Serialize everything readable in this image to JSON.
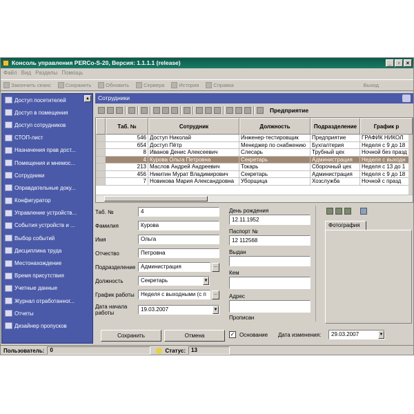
{
  "window": {
    "title": "Консоль управления PERCo-S-20, Версия: 1.1.1.1 (release)"
  },
  "menu": [
    "Файл",
    "Вид",
    "Разделы",
    "Помощь"
  ],
  "toolbar": {
    "items": [
      "Закончить сеанс",
      "Сохранить",
      "Обновить",
      "Сервера",
      "История",
      "Справка"
    ],
    "exit": "Выход"
  },
  "sidebar": {
    "items": [
      "Доступ посетителей",
      "Доступ в помещения",
      "Доступ сотрудников",
      "СТОП-лист",
      "Назначения прав дост...",
      "Помещения и мнемос...",
      "Сотрудники",
      "Оправдательные доку...",
      "Конфигуратор",
      "Управление устройств...",
      "События устройств и ...",
      "Выбор событий",
      "Дисциплина труда",
      "Местонахождение",
      "Время присутствия",
      "Учетные данные",
      "Журнал отработанног...",
      "Отчеты",
      "Дизайнер пропусков"
    ]
  },
  "panel": {
    "title": "Сотрудники",
    "filter_label": "Предприятие"
  },
  "table": {
    "headers": [
      "Таб. №",
      "Сотрудник",
      "Должность",
      "Подразделение",
      "График р"
    ],
    "rows": [
      [
        "546",
        "Доступ Николай",
        "Инженер-тестировщик",
        "Предприятие",
        "ГРАФИК НИКОЛ"
      ],
      [
        "654",
        "Доступ Пётр",
        "Менеджер по снабжению",
        "Бухгалтерия",
        "Неделя с 9 до 18"
      ],
      [
        "8",
        "Иванов Денис Алексеевич",
        "Слесарь",
        "Трубный цех",
        "Ночной без празд"
      ],
      [
        "4",
        "Курова Ольга Петровна",
        "Секретарь",
        "Администрация",
        "Неделя с выходн"
      ],
      [
        "213",
        "Маслов Андрей Андреевич",
        "Токарь",
        "Сборочный цех",
        "Неделя с 13 до 1"
      ],
      [
        "456",
        "Никитин Мурат Владимирович",
        "Секретарь",
        "Администрация",
        "Неделя с 9 до 18"
      ],
      [
        "7",
        "Новикова Мария Александровна",
        "Уборщица",
        "Хозслужба",
        "Ночной с празд"
      ]
    ],
    "selected_index": 3
  },
  "form": {
    "tab_no_label": "Таб. №",
    "tab_no": "4",
    "surname_label": "Фамилия",
    "surname": "Курова",
    "name_label": "Имя",
    "name": "Ольга",
    "patronymic_label": "Отчество",
    "patronymic": "Петровна",
    "department_label": "Подразделение",
    "department": "Администрация",
    "position_label": "Должность",
    "position": "Секретарь",
    "schedule_label": "График работы",
    "schedule": "Неделя с выходными (с п",
    "start_date_label": "Дата начала работы",
    "start_date": "19.03.2007"
  },
  "middle": {
    "birthday_label": "День рождения",
    "birthday": "12.11.1952",
    "passport_label": "Паспорт №",
    "passport": "12 112568",
    "issued_label": "Выдан",
    "issued": "",
    "by_label": "Кем",
    "by": "",
    "address_label": "Адрес",
    "address": "",
    "registered_label": "Прописан"
  },
  "right": {
    "photo_tab": "Фотография"
  },
  "bottom": {
    "save": "Сохранить",
    "cancel": "Отмена",
    "basis_label": "Основание",
    "basis_checked": true,
    "changed_label": "Дата изменения:",
    "changed": "29.03.2007"
  },
  "status": {
    "user_label": "Пользователь:",
    "user": "0",
    "status_label": "Статус:",
    "status": "13"
  },
  "colors": {
    "sidebar": "#4a5aa8",
    "title": "#1b7a64",
    "selection": "#a08770"
  }
}
